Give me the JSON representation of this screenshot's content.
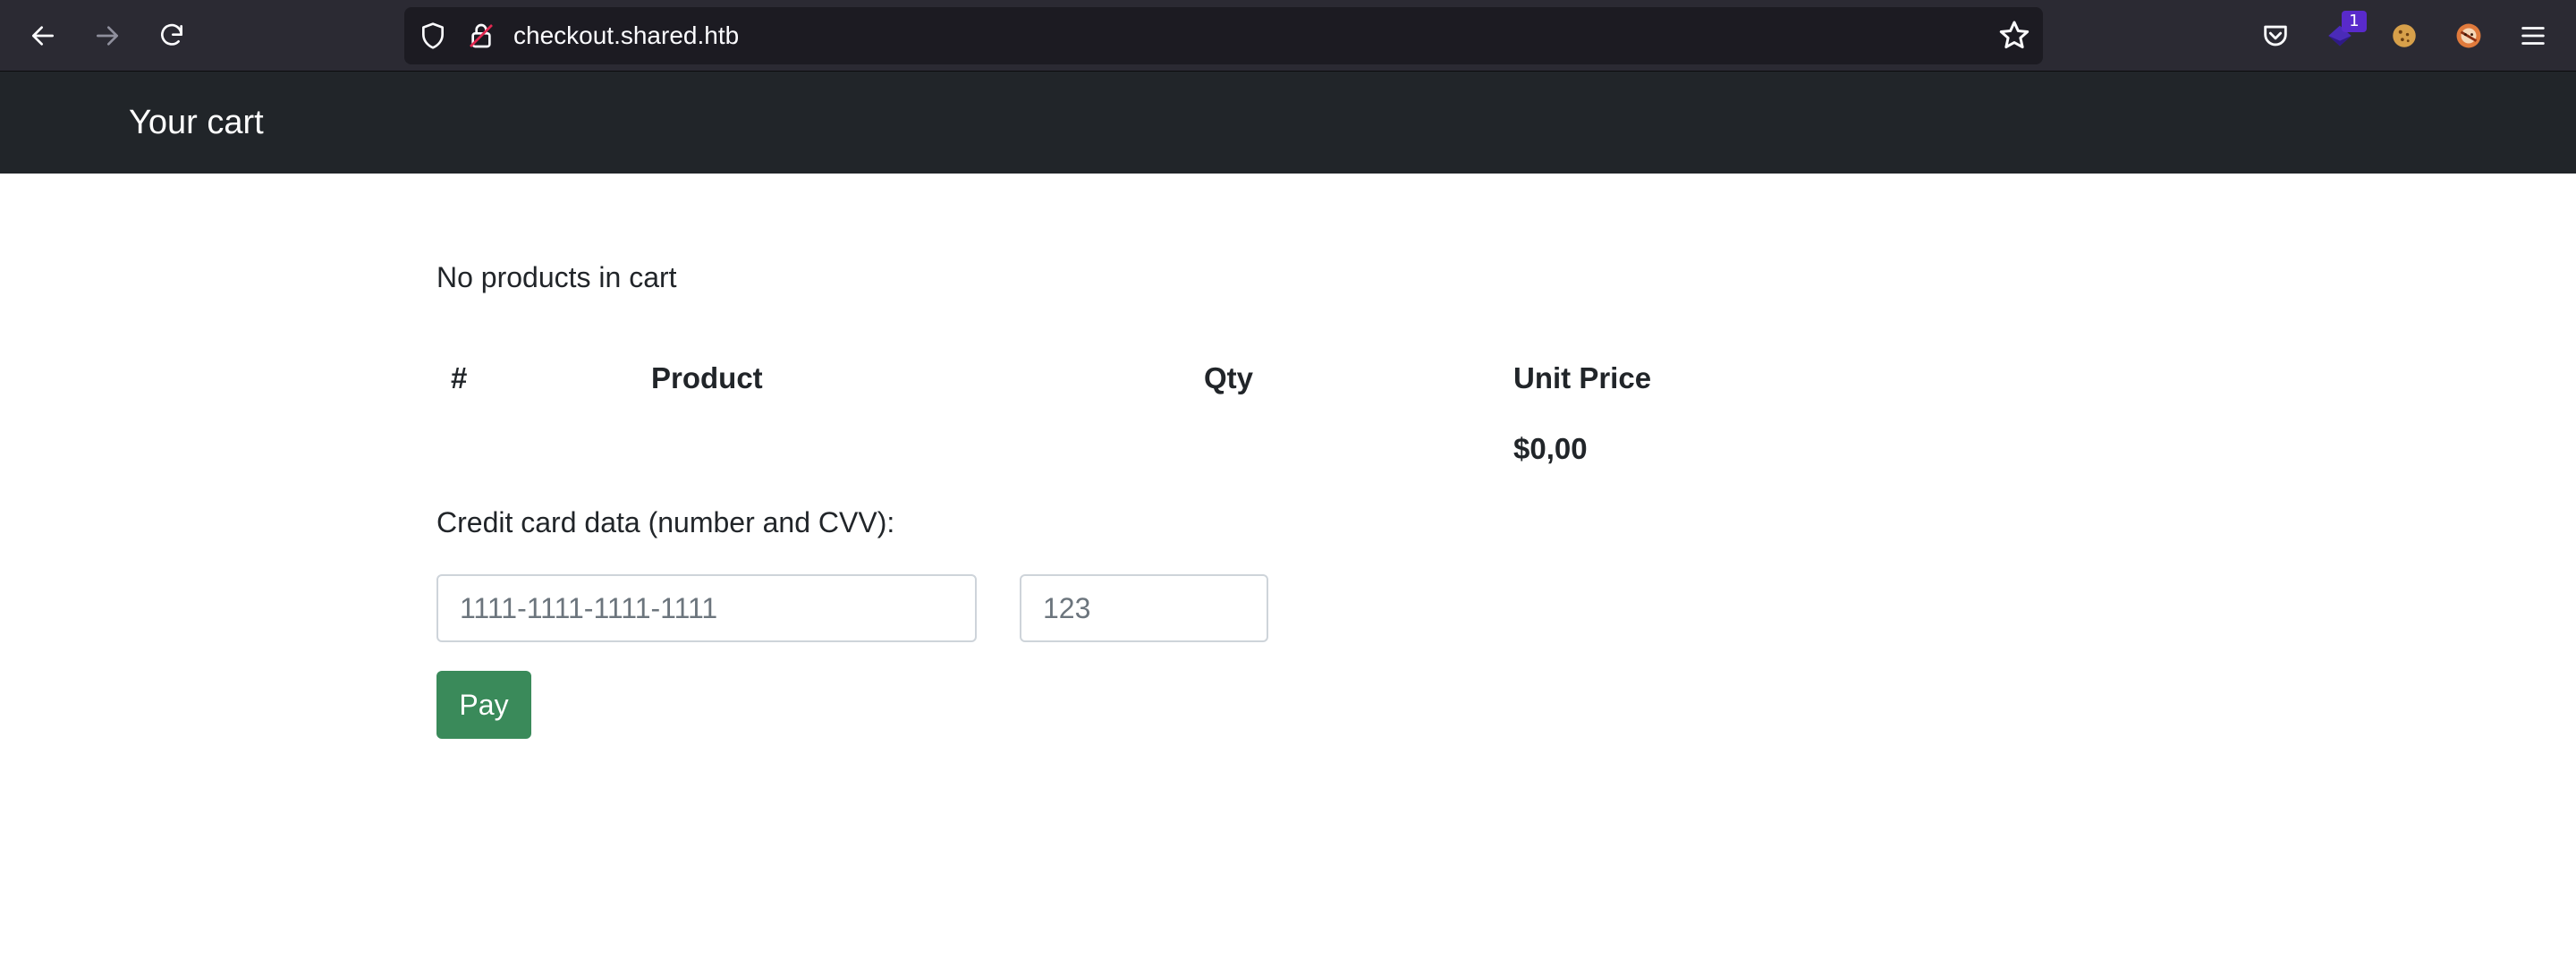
{
  "browser": {
    "url": "checkout.shared.htb",
    "extension_badge": "1",
    "icons": {
      "back": "back-arrow-icon",
      "forward": "forward-arrow-icon",
      "reload": "reload-icon",
      "shield": "tracking-protection-shield-icon",
      "lock": "insecure-lock-icon",
      "bookmark": "bookmark-star-icon",
      "pocket": "pocket-icon",
      "extension": "extension-icon",
      "cookie": "cookie-icon",
      "profile": "profile-avatar-icon",
      "menu": "hamburger-menu-icon"
    }
  },
  "header": {
    "title": "Your cart"
  },
  "cart": {
    "empty_message": "No products in cart",
    "columns": [
      "#",
      "Product",
      "Qty",
      "Unit Price"
    ],
    "total": "$0,00"
  },
  "payment": {
    "label": "Credit card data (number and CVV):",
    "card_placeholder": "1111-1111-1111-1111",
    "cvv_placeholder": "123",
    "pay_label": "Pay"
  },
  "colors": {
    "header_bg": "#212529",
    "pay_button": "#3a8a5a",
    "browser_bg": "#2b2a33"
  }
}
